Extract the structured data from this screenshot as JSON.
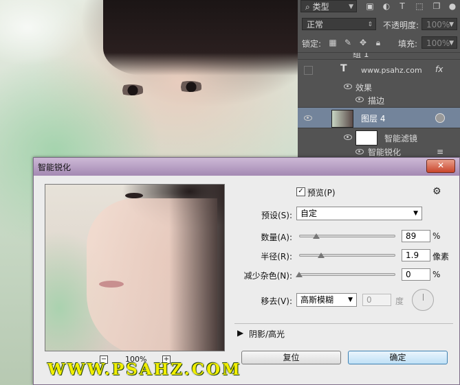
{
  "layers_panel": {
    "filter_type": "类型",
    "blend_mode": "正常",
    "opacity_label": "不透明度:",
    "opacity_value": "100%",
    "lock_label": "锁定:",
    "fill_label": "填充:",
    "fill_value": "100%",
    "group_partial": "组 1",
    "text_layer": "www.psahz.com",
    "fx_label": "fx",
    "effects_label": "效果",
    "stroke_label": "描边",
    "layer4": "图层 4",
    "smart_filters": "智能滤镜",
    "smart_sharpen_row": "智能锐化"
  },
  "dialog": {
    "title": "智能锐化",
    "close_glyph": "✕",
    "preview_label": "预览(P)",
    "preview_checked": true,
    "gear_glyph": "⚙",
    "preset_label": "预设(S):",
    "preset_value": "自定",
    "amount_label": "数量(A):",
    "amount_value": "89",
    "amount_unit": "%",
    "amount_fraction": 0.18,
    "radius_label": "半径(R):",
    "radius_value": "1.9",
    "radius_unit": "像素",
    "radius_fraction": 0.23,
    "noise_label": "减少杂色(N):",
    "noise_value": "0",
    "noise_unit": "%",
    "noise_fraction": 0.0,
    "remove_label": "移去(V):",
    "remove_value": "高斯模糊",
    "angle_value": "0",
    "angle_unit": "度",
    "shadow_highlight": "阴影/高光",
    "reset_button": "复位",
    "ok_button": "确定",
    "zoom_minus": "−",
    "zoom_plus": "+",
    "zoom_level": "100%",
    "watermark": "WWW.PSAHZ.COM"
  }
}
